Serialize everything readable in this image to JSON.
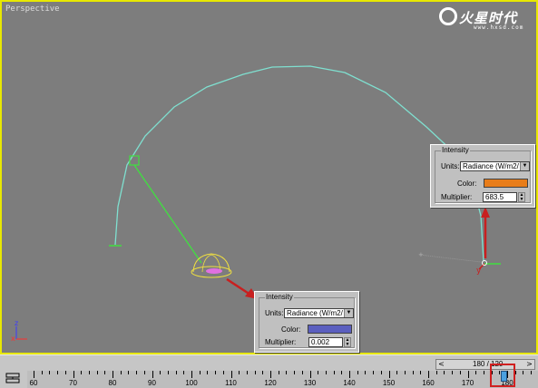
{
  "viewport": {
    "label": "Perspective",
    "border_color": "#e8e800"
  },
  "logo": {
    "text": "火星时代",
    "url": "www.hxsd.com"
  },
  "axis_labels": {
    "z": "z",
    "x": "x",
    "y": "y"
  },
  "panel_top": {
    "title": "Intensity",
    "units_label": "Units:",
    "units_value": "Radiance (W/m2/",
    "color_label": "Color:",
    "color_value": "#e87d1a",
    "multiplier_label": "Multiplier:",
    "multiplier_value": "683.5"
  },
  "panel_bottom": {
    "title": "Intensity",
    "units_label": "Units:",
    "units_value": "Radiance (W/m2/",
    "color_label": "Color:",
    "color_value": "#5b5fbf",
    "multiplier_label": "Multiplier:",
    "multiplier_value": "0.002"
  },
  "timeline": {
    "slider_text": "180 / 120",
    "prev_icon": "chevron-left-icon",
    "next_icon": "chevron-right-icon",
    "ticks": [
      "60",
      "70",
      "80",
      "90",
      "100",
      "110",
      "120",
      "130",
      "140",
      "150",
      "160",
      "170",
      "180"
    ]
  },
  "colors": {
    "arc": "#7fe0d0",
    "helper": "#40e040",
    "arrow": "#c82020",
    "dome": "#f0e040"
  }
}
